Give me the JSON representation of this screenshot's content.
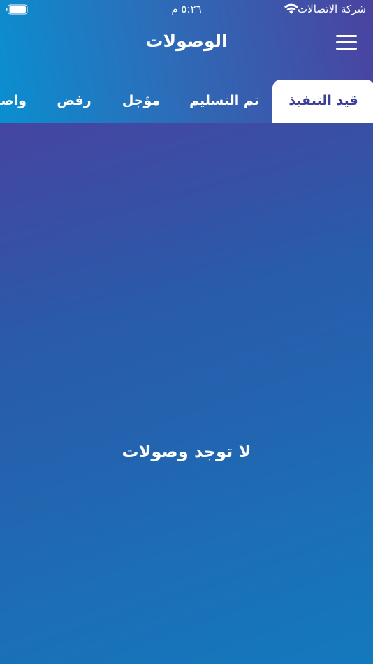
{
  "status_bar": {
    "carrier": "شركة الاتصالات",
    "time": "٥:٢٦ م",
    "wifi_icon": "wifi-icon",
    "battery_icon": "battery-icon"
  },
  "header": {
    "title": "الوصولات",
    "menu_icon": "hamburger-menu-icon"
  },
  "tabs": [
    {
      "label": "قيد التنفيذ",
      "active": true
    },
    {
      "label": "تم التسليم",
      "active": false
    },
    {
      "label": "مؤجل",
      "active": false
    },
    {
      "label": "رفض",
      "active": false
    },
    {
      "label": "واصل",
      "active": false
    }
  ],
  "empty_state": {
    "message": "لا توجد وصولات"
  },
  "colors": {
    "accent": "#3b3f96",
    "header_start": "#0a8fd0",
    "header_end": "#4a43a0",
    "background_end": "#1479bd"
  }
}
